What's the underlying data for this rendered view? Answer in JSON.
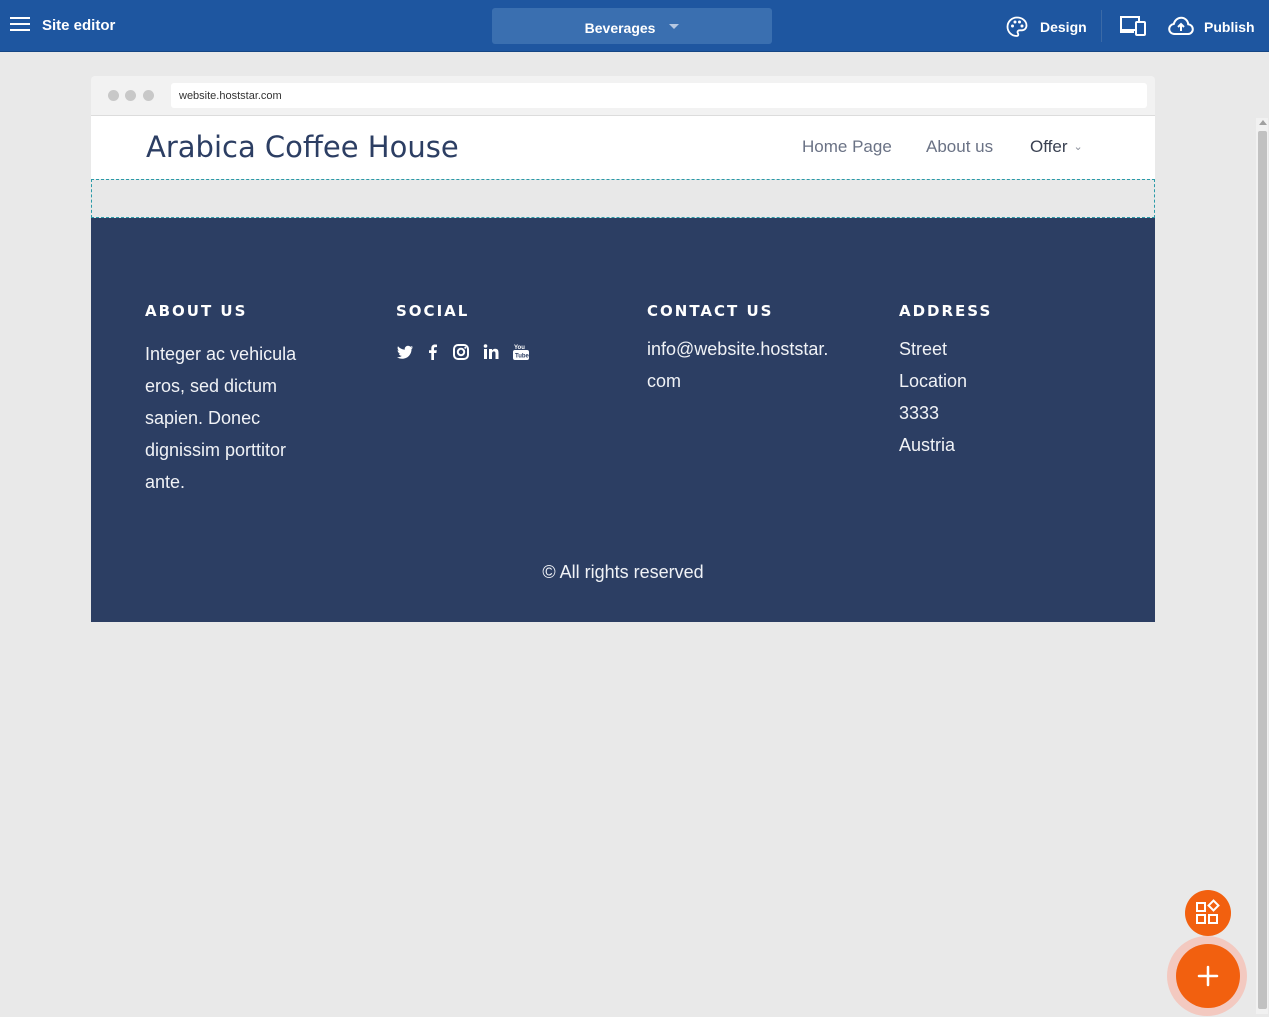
{
  "topbar": {
    "title": "Site editor",
    "page_selector": "Beverages",
    "design_label": "Design",
    "publish_label": "Publish"
  },
  "browser": {
    "url": "website.hoststar.com"
  },
  "site": {
    "brand": "Arabica Coffee House",
    "nav": [
      "Home Page",
      "About us",
      "Offer"
    ]
  },
  "footer": {
    "about": {
      "heading": "ABOUT US",
      "lines": [
        "Integer ac vehicula",
        "eros, sed dictum",
        "sapien. Donec",
        "dignissim porttitor",
        "ante."
      ]
    },
    "social": {
      "heading": "SOCIAL",
      "icons": [
        "twitter-icon",
        "facebook-icon",
        "instagram-icon",
        "linkedin-icon",
        "youtube-icon"
      ]
    },
    "contact": {
      "heading": "CONTACT US",
      "lines": [
        "info@website.hoststar.",
        "com"
      ]
    },
    "address": {
      "heading": "ADDRESS",
      "lines": [
        "Street",
        "Location",
        "3333",
        "Austria"
      ]
    },
    "copyright": "© All rights reserved"
  },
  "colors": {
    "topbar": "#1e56a0",
    "footer": "#2c3e63",
    "fab": "#f2600f"
  }
}
